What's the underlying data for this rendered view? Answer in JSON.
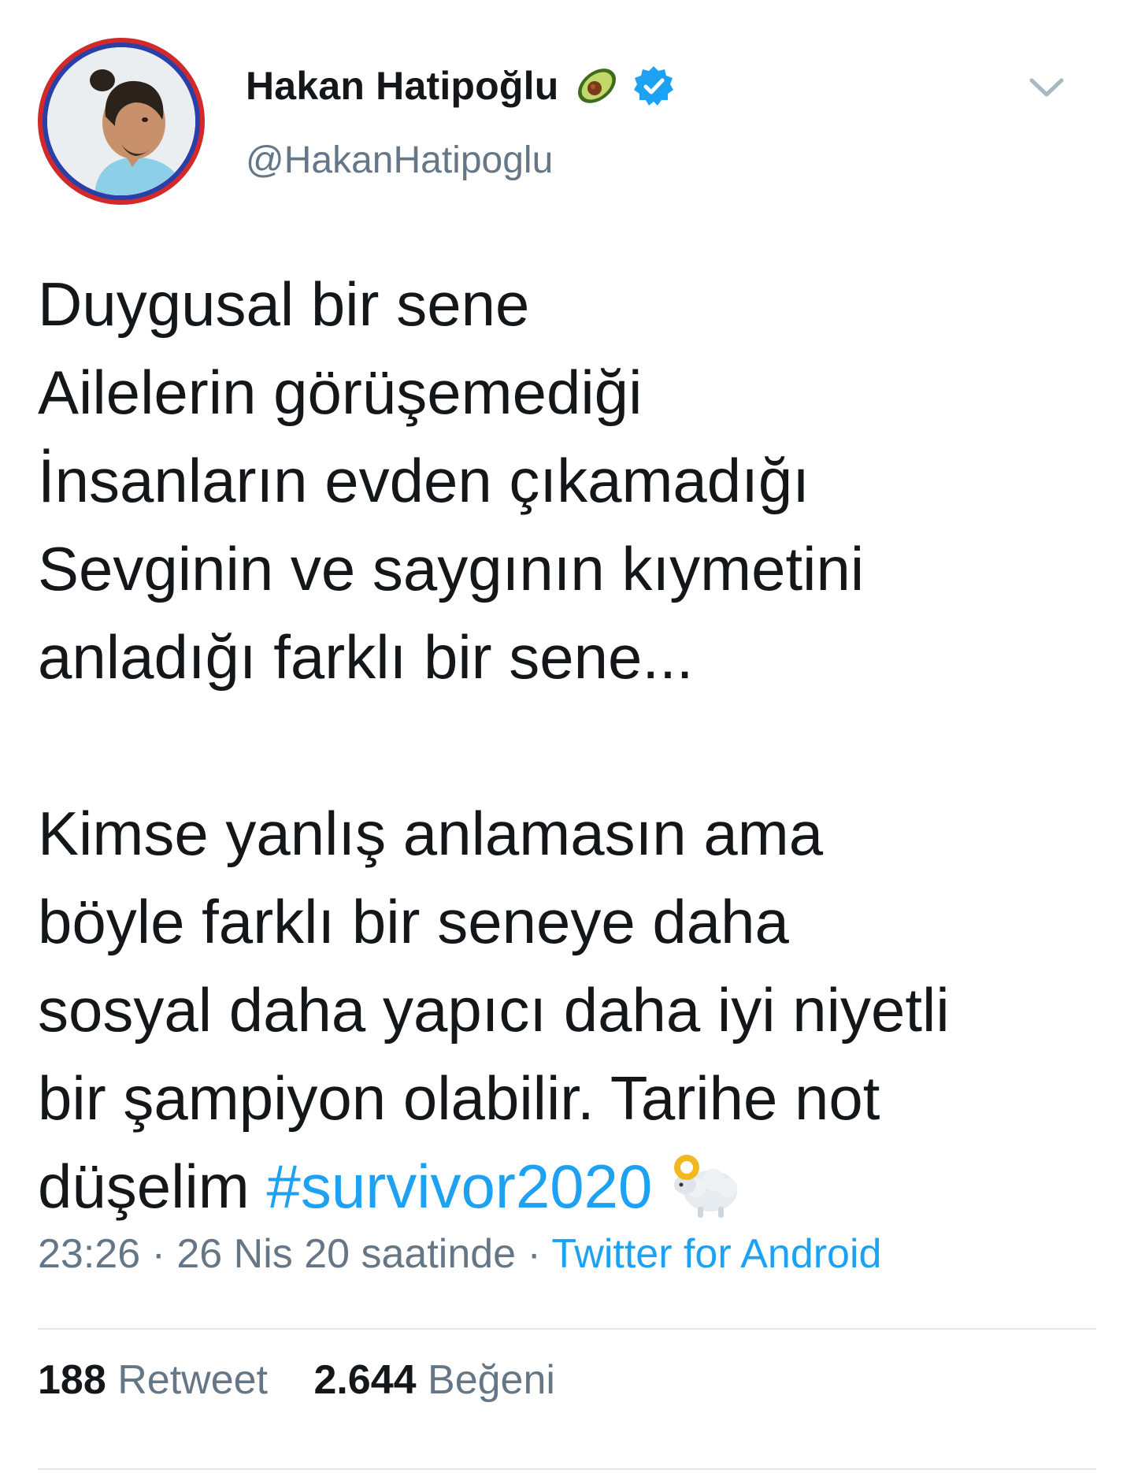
{
  "user": {
    "display_name": "Hakan Hatipoğlu",
    "handle": "@HakanHatipoglu",
    "name_emoji": "avocado-icon",
    "verified": true
  },
  "tweet": {
    "text": "Duygusal bir sene\nAilelerin görüşemediği\nİnsanların evden çıkamadığı\nSevginin ve saygının kıymetini\nanladığı farklı bir sene...\n\nKimse yanlış anlamasın ama\nböyle farklı bir seneye daha\nsosyal daha yapıcı daha iyi niyetli\nbir şampiyon olabilir. Tarihe not\ndüşelim ",
    "hashtag": "#survivor2020",
    "trailing_emoji": "ram-icon"
  },
  "meta": {
    "time": "23:26",
    "separator1": " · ",
    "date": "26 Nis 20 saatinde",
    "separator2": " · ",
    "source": "Twitter for Android"
  },
  "stats": {
    "retweets_count": "188",
    "retweets_label": "Retweet",
    "likes_count": "2.644",
    "likes_label": "Beğeni"
  },
  "colors": {
    "link": "#1da1f2",
    "secondary_text": "#657786",
    "verified": "#1da1f2",
    "divider": "#e1e8ed"
  }
}
